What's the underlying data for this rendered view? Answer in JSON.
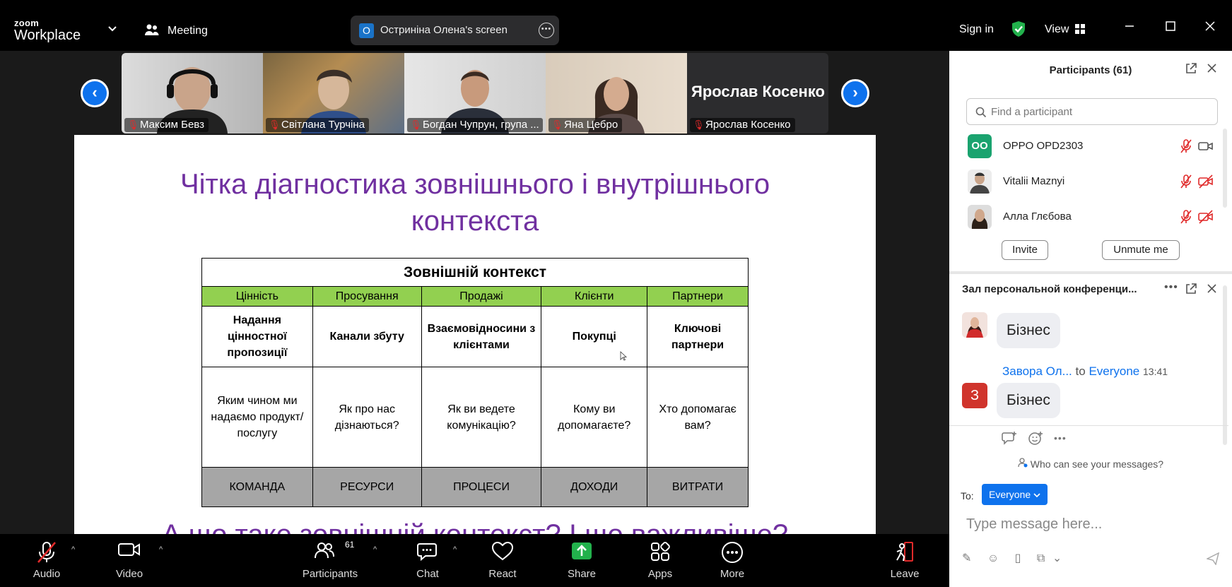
{
  "titlebar": {
    "logo_line1": "zoom",
    "logo_line2": "Workplace",
    "meeting_label": "Meeting",
    "share_initial": "O",
    "share_label": "Остриніна Олена's screen",
    "signin": "Sign in",
    "view": "View"
  },
  "strip": {
    "tiles": [
      {
        "name": "Максим Бевз"
      },
      {
        "name": "Світлана Турчіна"
      },
      {
        "name": "Богдан Чупрун, група ..."
      },
      {
        "name": "Яна Цебро"
      },
      {
        "name": "Ярослав Косенко",
        "big_name": "Ярослав Косенко"
      }
    ]
  },
  "slide": {
    "title_line1": "Чітка діагностика зовнішнього і внутрішнього",
    "title_line2": "контекста",
    "table_title": "Зовнішній контекст",
    "columns": [
      "Цінність",
      "Просування",
      "Продажі",
      "Клієнти",
      "Партнери"
    ],
    "row_bold": [
      "Надання цінностної пропозиції",
      "Канали збуту",
      "Взаємовідносини з клієнтами",
      "Покупці",
      "Ключові партнери"
    ],
    "row_questions": [
      "Яким чином ми надаємо продукт/послугу",
      "Як про нас дізнаються?",
      "Як ви ведете комунікацію?",
      "Кому ви допомагаєте?",
      "Хто допомагає вам?"
    ],
    "row_footer": [
      "КОМАНДА",
      "РЕСУРСИ",
      "ПРОЦЕСИ",
      "ДОХОДИ",
      "ВИТРАТИ"
    ],
    "bottom_text": "А що таке зовнішній контекст? І що важливіше?"
  },
  "toolbar": {
    "audio": "Audio",
    "video": "Video",
    "participants": "Participants",
    "participants_count": "61",
    "chat": "Chat",
    "react": "React",
    "share": "Share",
    "apps": "Apps",
    "more": "More",
    "leave": "Leave"
  },
  "participants_panel": {
    "title": "Participants (61)",
    "search_placeholder": "Find a participant",
    "list": [
      {
        "initials": "OO",
        "name": "OPPO OPD2303"
      },
      {
        "name": "Vitalii Maznyi"
      },
      {
        "name": "Алла Глєбова"
      }
    ],
    "invite": "Invite",
    "unmute_me": "Unmute me"
  },
  "chat_panel": {
    "title": "Зал персональной конференци...",
    "messages": [
      {
        "text": "Бізнес"
      },
      {
        "sender": "Завора Ол...",
        "to_label": "to",
        "to": "Everyone",
        "time": "13:41",
        "avatar_initial": "З",
        "text": "Бізнес"
      }
    ],
    "who_can_see": "Who can see your messages?",
    "to_label": "To:",
    "recipient": "Everyone",
    "input_placeholder": "Type message here..."
  },
  "colors": {
    "accent": "#0e72ed",
    "slide_title": "#7030a0",
    "table_green": "#92d050",
    "table_grey": "#a6a6a6",
    "mute_red": "#e02a2a",
    "shield_green": "#22b14c"
  }
}
